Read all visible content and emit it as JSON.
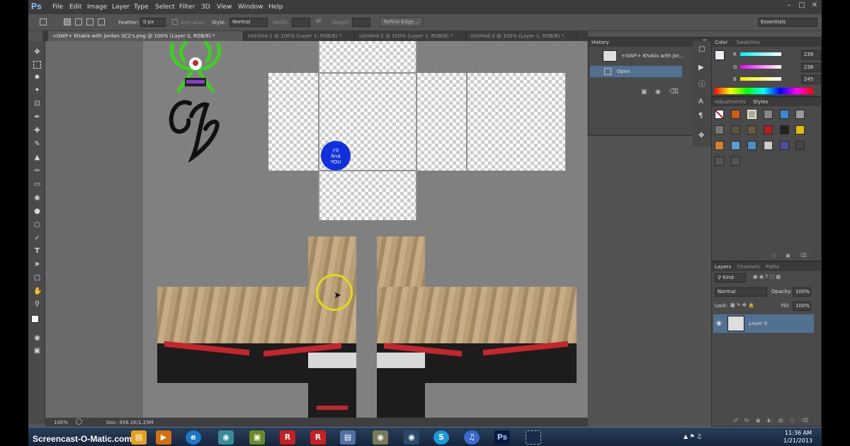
{
  "app": {
    "logo": "Ps"
  },
  "menu": [
    "File",
    "Edit",
    "Image",
    "Layer",
    "Type",
    "Select",
    "Filter",
    "3D",
    "View",
    "Window",
    "Help"
  ],
  "options": {
    "feather_label": "Feather:",
    "feather_value": "0 px",
    "antialias_label": "Anti-alias",
    "style_label": "Style:",
    "style_value": "Normal",
    "width_label": "Width:",
    "height_label": "Height:",
    "refine_edge": "Refine Edge...",
    "workspace": "Essentials"
  },
  "tabs": [
    "+GWF+ Khakis with Jordan SC2's.png @ 100% (Layer 0, RGB/8) *",
    "Untitled-1 @ 100% (Layer 1, RGB/8) *",
    "Untitled-2 @ 100% (Layer 1, RGB/8) *",
    "Untitled-3 @ 100% (Layer 1, RGB/8) *"
  ],
  "canvas": {
    "logo_text": "Gʃ",
    "badge_lines": [
      "I'll",
      "find",
      "YOU"
    ]
  },
  "status": {
    "zoom": "100%",
    "doc": "Doc: 958.1K/1.25M"
  },
  "history": {
    "title": "History",
    "snapshot": "+GWF+ Khakis with Jor...",
    "step": "Open"
  },
  "color_panel": {
    "tabs": [
      "Color",
      "Swatches"
    ],
    "r_label": "R",
    "r_value": "239",
    "g_label": "G",
    "g_value": "238",
    "b_label": "B",
    "b_value": "245"
  },
  "adjustments": {
    "tabs": [
      "Adjustments",
      "Styles"
    ]
  },
  "layers": {
    "tabs": [
      "Layers",
      "Channels",
      "Paths"
    ],
    "kind": "Kind",
    "blend_mode": "Normal",
    "opacity_label": "Opacity:",
    "opacity_value": "100%",
    "lock_label": "Lock:",
    "fill_label": "Fill:",
    "fill_value": "100%",
    "layer_name": "Layer 0"
  },
  "taskbar": {
    "watermark": "Screencast-O-Matic.com",
    "time": "11:36 AM",
    "date": "1/21/2013"
  },
  "colors": {
    "accent_blue": "#1030e0",
    "cursor_yellow": "#e2d81c",
    "logo_green": "#39d11e"
  }
}
